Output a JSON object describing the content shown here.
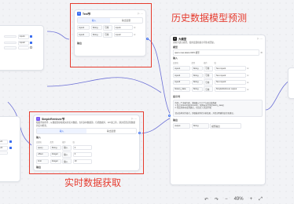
{
  "annotations": {
    "history_label": "历史数据模型预测",
    "realtime_label": "实时数据获取"
  },
  "node_left": {
    "rows": [
      {
        "name": "",
        "type": "",
        "value": "input1"
      },
      {
        "name": "",
        "type": "",
        "value": "input2"
      }
    ]
  },
  "node_bottom_left": {
    "rows": [
      {
        "value": "input1"
      },
      {
        "value": "input2"
      }
    ]
  },
  "node_top": {
    "title": "Text节",
    "tabs": [
      "输入",
      "输出变量"
    ],
    "rows": [
      {
        "name": "input1",
        "type": "String",
        "op": "引用",
        "val": "input1"
      },
      {
        "name": "input2",
        "type": "String",
        "op": "引用",
        "val": "input2"
      }
    ],
    "section": "输出"
  },
  "node_realtime": {
    "title": "SimpleRetriever节",
    "desc": "根据查询条件，从数据源获取相关的实时数据。支持多种数据源，包括数据库、API接口等，通过配置实现数据的实时检索。",
    "tabs": [
      "输入",
      "输出变量"
    ],
    "section": "输入",
    "headers": [
      "变量名",
      "类型",
      "操作",
      "值"
    ],
    "rows": [
      {
        "name": "query",
        "type": "String",
        "op": "输入",
        "val": "0"
      },
      {
        "name": "offset",
        "type": "Integer",
        "op": "输入",
        "val": "0"
      },
      {
        "name": "limit",
        "type": "Integer",
        "op": "输入",
        "val": "10"
      }
    ],
    "output": "输出"
  },
  "node_llm": {
    "title": "大模型",
    "desc": "调用大语言模型，使用变量和提示词生成回复。",
    "model_label": "模型",
    "model_value": "qwen-max-latest-0415 模型",
    "input_label": "输入",
    "headers": [
      "变量名",
      "类型",
      "操作",
      "值"
    ],
    "rows": [
      {
        "name": "input1",
        "type": "String",
        "op": "引用",
        "val": "Text·input1"
      },
      {
        "name": "input2",
        "type": "String",
        "op": "引用",
        "val": "Text·input2"
      },
      {
        "name": "input3",
        "type": "String",
        "op": "引用",
        "val": "Text·input3"
      },
      {
        "name": "history_data",
        "type": "String",
        "op": "引用",
        "val": "SimpleRetriever·output"
      }
    ],
    "prompt_label": "提示词",
    "prompt_lines": [
      "你是一个金融专家，请根据以下几个方面分析数据：",
      "1. 结合{{input1}}和{{input2}}，预测未来走势{{history_data}}",
      "2. 给出具体的投资建议，包括买入/卖出时机",
      "",
      "请以结构化的格式，详细描述你的分析结果，并给出明确的结论和建议。"
    ],
    "output_label": "输出",
    "output_rows": [
      {
        "name": "output",
        "type": "String",
        "desc": "模型输出"
      }
    ]
  },
  "toolbar": {
    "zoom": "49%",
    "undo": "↶",
    "redo": "↷",
    "zoom_out": "−",
    "zoom_in": "+",
    "fit": "⤢"
  },
  "colors": {
    "accent": "#3a6df0",
    "annotation": "#e63b2e",
    "link": "#6b6fd6"
  }
}
